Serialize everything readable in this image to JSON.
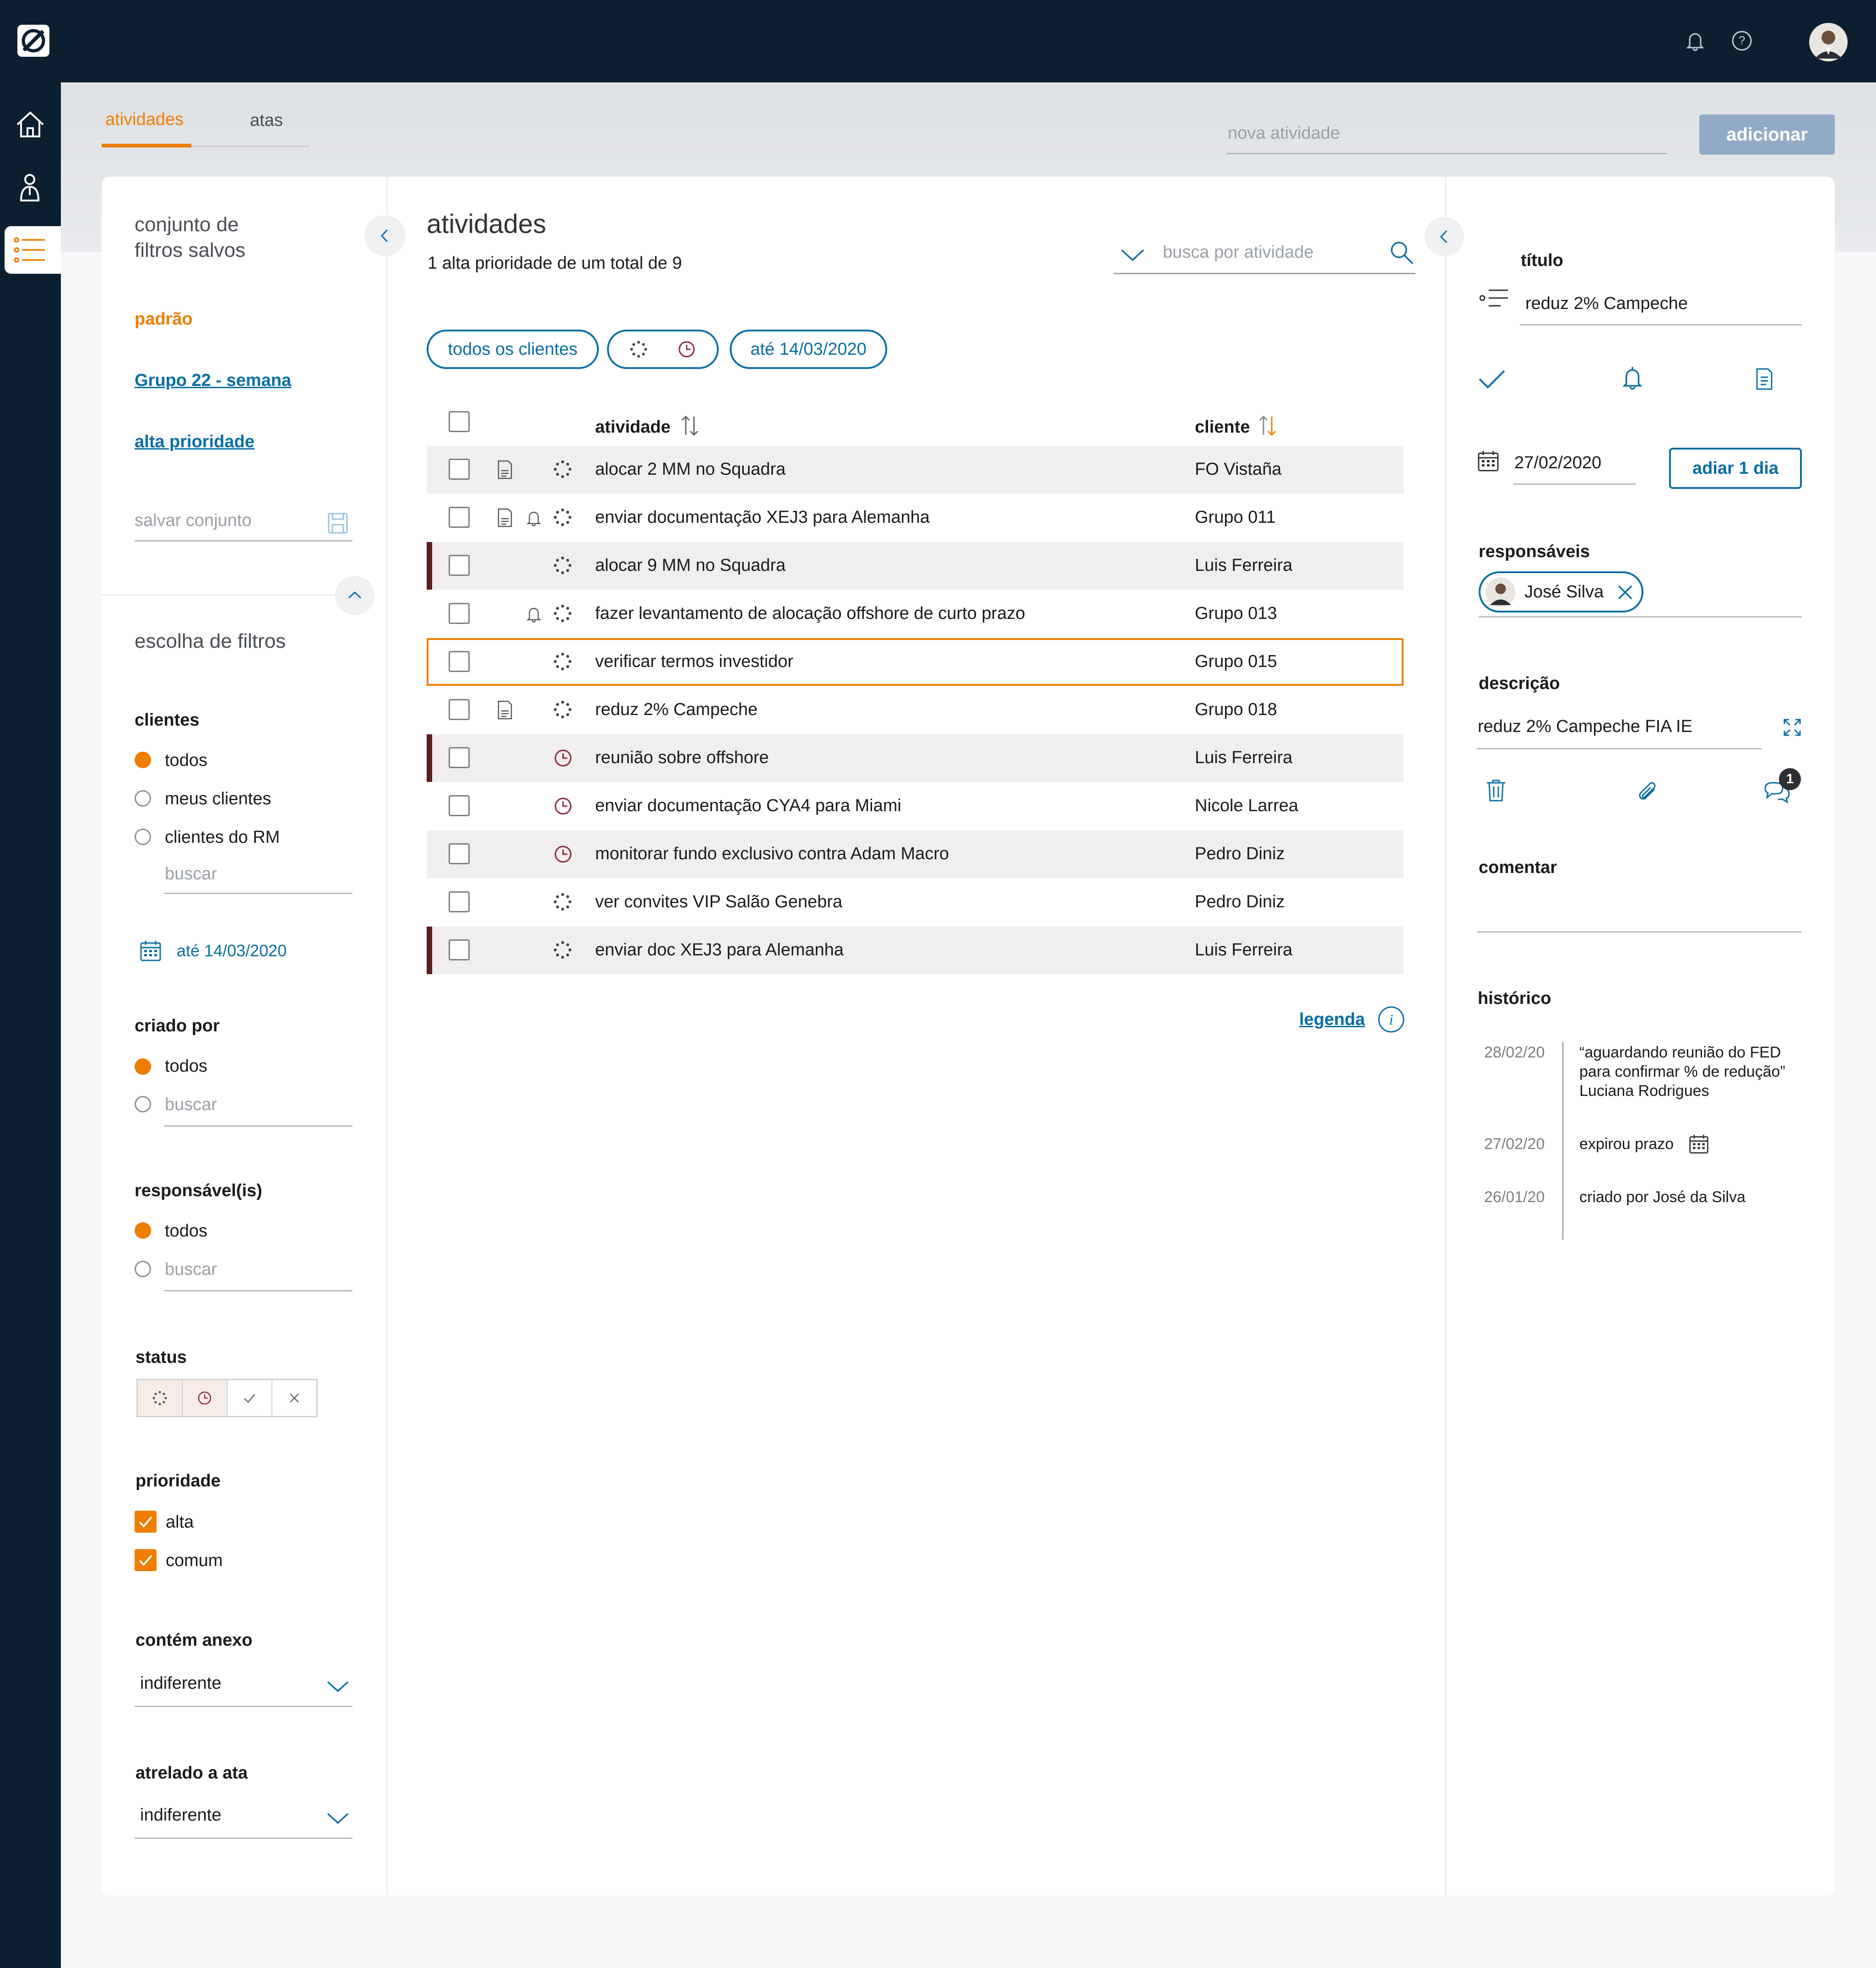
{
  "header": {
    "logo": "logo-slash-icon",
    "notification_icon": "bell-icon",
    "help_icon": "help-icon"
  },
  "nav": {
    "items": [
      "home-icon",
      "clients-icon",
      "activities-list-icon"
    ]
  },
  "tabs": [
    {
      "label": "atividades",
      "active": true
    },
    {
      "label": "atas",
      "active": false
    }
  ],
  "new_activity": {
    "placeholder": "nova atividade",
    "button": "adicionar"
  },
  "filters_panel": {
    "saved_title_1": "conjunto de",
    "saved_title_2": "filtros salvos",
    "saved": [
      "padrão",
      "Grupo 22 - semana",
      "alta prioridade"
    ],
    "save_placeholder": "salvar conjunto",
    "choose_title": "escolha de filtros",
    "clients": {
      "title": "clientes",
      "options": [
        "todos",
        "meus clientes",
        "clientes do RM"
      ],
      "selected": "todos",
      "search_placeholder": "buscar",
      "date": "até 14/03/2020"
    },
    "created_by": {
      "title": "criado por",
      "option": "todos",
      "search_placeholder": "buscar"
    },
    "responsible": {
      "title": "responsável(is)",
      "option": "todos",
      "search_placeholder": "buscar"
    },
    "status": {
      "title": "status",
      "icons": [
        "in-progress-icon",
        "pending-clock-icon",
        "done-check-icon",
        "canceled-x-icon"
      ]
    },
    "priority": {
      "title": "prioridade",
      "options": [
        "alta",
        "comum"
      ],
      "checked": [
        true,
        true
      ]
    },
    "attachment": {
      "title": "contém anexo",
      "value": "indiferente"
    },
    "minutes": {
      "title": "atrelado a ata",
      "value": "indiferente"
    }
  },
  "activities": {
    "title": "atividades",
    "subtitle": "1 alta prioridade de um total de 9",
    "search_placeholder": "busca por atividade",
    "chips": [
      "todos os clientes",
      "até 14/03/2020"
    ],
    "col_activity": "atividade",
    "col_client": "cliente",
    "rows": [
      {
        "activity": "alocar 2 MM no Squadra",
        "client": "FO Vistaña",
        "high": false,
        "doc": true,
        "bell": false,
        "status": "progress",
        "alt": true,
        "selected": false
      },
      {
        "activity": "enviar documentação XEJ3 para Alemanha",
        "client": "Grupo 011",
        "high": false,
        "doc": true,
        "bell": true,
        "status": "progress",
        "alt": false,
        "selected": false
      },
      {
        "activity": "alocar 9 MM no Squadra",
        "client": "Luis Ferreira",
        "high": true,
        "doc": false,
        "bell": false,
        "status": "progress",
        "alt": true,
        "selected": false
      },
      {
        "activity": "fazer levantamento de alocação offshore de curto prazo",
        "client": "Grupo 013",
        "high": false,
        "doc": false,
        "bell": true,
        "status": "progress",
        "alt": false,
        "selected": false
      },
      {
        "activity": "verificar termos investidor",
        "client": "Grupo 015",
        "high": false,
        "doc": false,
        "bell": false,
        "status": "progress",
        "alt": false,
        "selected": true
      },
      {
        "activity": "reduz 2% Campeche",
        "client": "Grupo 018",
        "high": false,
        "doc": true,
        "bell": false,
        "status": "progress",
        "alt": false,
        "selected": false
      },
      {
        "activity": "reunião sobre offshore",
        "client": "Luis Ferreira",
        "high": true,
        "doc": false,
        "bell": false,
        "status": "clock",
        "alt": true,
        "selected": false
      },
      {
        "activity": "enviar documentação CYA4 para Miami",
        "client": "Nicole Larrea",
        "high": false,
        "doc": false,
        "bell": false,
        "status": "clock",
        "alt": false,
        "selected": false
      },
      {
        "activity": "monitorar fundo exclusivo contra Adam Macro",
        "client": "Pedro Diniz",
        "high": false,
        "doc": false,
        "bell": false,
        "status": "clock",
        "alt": true,
        "selected": false
      },
      {
        "activity": "ver convites VIP Salão Genebra",
        "client": "Pedro Diniz",
        "high": false,
        "doc": false,
        "bell": false,
        "status": "progress",
        "alt": false,
        "selected": false
      },
      {
        "activity": "enviar doc XEJ3 para Alemanha",
        "client": "Luis Ferreira",
        "high": true,
        "doc": false,
        "bell": false,
        "status": "progress",
        "alt": true,
        "selected": false
      }
    ],
    "legend": "legenda"
  },
  "detail": {
    "title_label": "título",
    "title_value": "reduz 2% Campeche",
    "date": "27/02/2020",
    "postpone": "adiar 1 dia",
    "responsibles_label": "responsáveis",
    "responsible": "José Silva",
    "description_label": "descrição",
    "description": "reduz 2% Campeche FIA IE",
    "comment_count": "1",
    "comment_label": "comentar",
    "history_label": "histórico",
    "history": [
      {
        "date": "28/02/20",
        "lines": [
          "“aguardando reunião do FED",
          "para confirmar % de redução”",
          "Luciana Rodrigues"
        ]
      },
      {
        "date": "27/02/20",
        "lines": [
          "expirou prazo"
        ]
      },
      {
        "date": "26/01/20",
        "lines": [
          "criado por José da Silva"
        ]
      }
    ]
  },
  "colors": {
    "navy": "#0c1f31",
    "orange": "#ef7d00",
    "teal": "#0b6ea3",
    "high_priority": "#5a1e1e",
    "clock": "#8b2f4a"
  }
}
